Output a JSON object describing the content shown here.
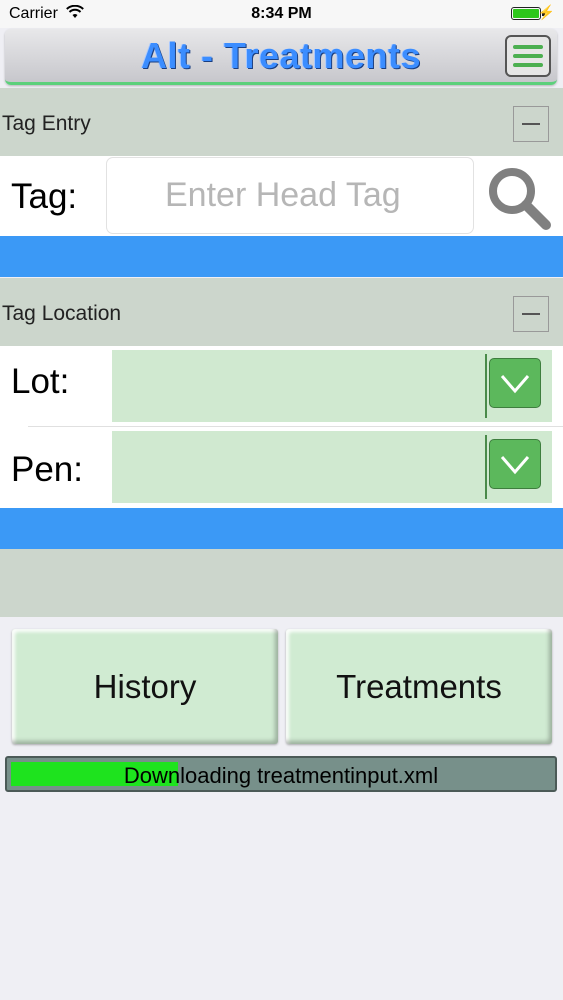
{
  "status_bar": {
    "carrier": "Carrier",
    "time": "8:34 PM"
  },
  "header": {
    "title": "Alt - Treatments",
    "menu_icon": "hamburger-menu-icon"
  },
  "tag_entry": {
    "section_label": "Tag Entry",
    "tag_label": "Tag:",
    "tag_placeholder": "Enter Head Tag",
    "search_icon": "magnifier-search-icon"
  },
  "tag_location": {
    "section_label": "Tag Location",
    "lot_label": "Lot:",
    "lot_value": "",
    "pen_label": "Pen:",
    "pen_value": ""
  },
  "actions": {
    "history_label": "History",
    "treatments_label": "Treatments"
  },
  "progress": {
    "text": "Downloading treatmentinput.xml",
    "fraction": 0.31
  },
  "colors": {
    "accent_blue": "#3b99f6",
    "title_blue": "#3b8dff",
    "panel_gray": "#ccd6cc",
    "field_green": "#d0e9d0",
    "button_green": "#5cb85c",
    "progress_green": "#1ee31e"
  }
}
